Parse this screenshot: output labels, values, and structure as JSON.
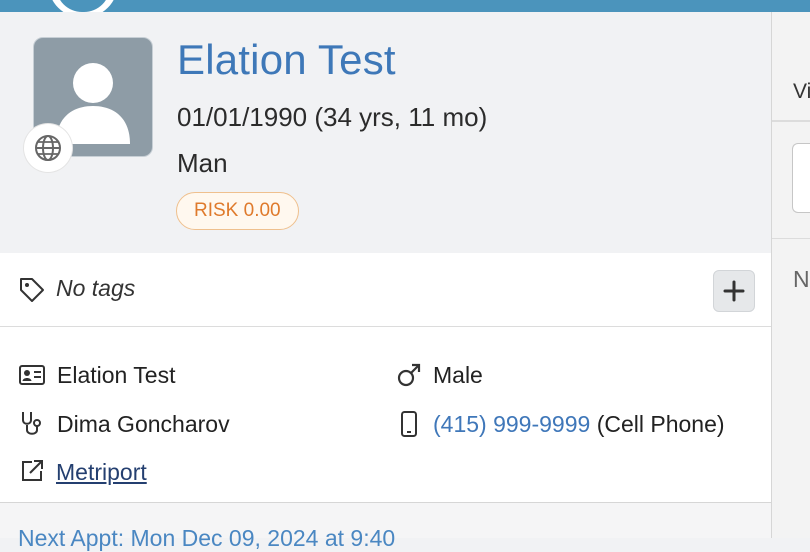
{
  "patient": {
    "name": "Elation Test",
    "dob_age": "01/01/1990 (34 yrs, 11 mo)",
    "sex": "Man",
    "risk": "RISK 0.00"
  },
  "tags": {
    "empty_label": "No tags"
  },
  "details": {
    "legal_name": "Elation Test",
    "gender": "Male",
    "provider": "Dima Goncharov",
    "phone": "(415) 999-9999",
    "phone_type": "(Cell Phone)",
    "external_link": "Metriport"
  },
  "next_appointment": "Next Appt: Mon Dec 09, 2024 at 9:40",
  "right_panel": {
    "tab_fragment": "Vi",
    "fragment_n": "N"
  },
  "colors": {
    "topbar": "#4b94bc",
    "name_blue": "#3e78b8",
    "risk_orange": "#df7a2c",
    "link_blue": "#3f77b9"
  },
  "icons": [
    "globe-icon",
    "tag-icon",
    "plus-icon",
    "id-card-icon",
    "male-icon",
    "stethoscope-icon",
    "mobile-phone-icon",
    "external-link-icon"
  ]
}
